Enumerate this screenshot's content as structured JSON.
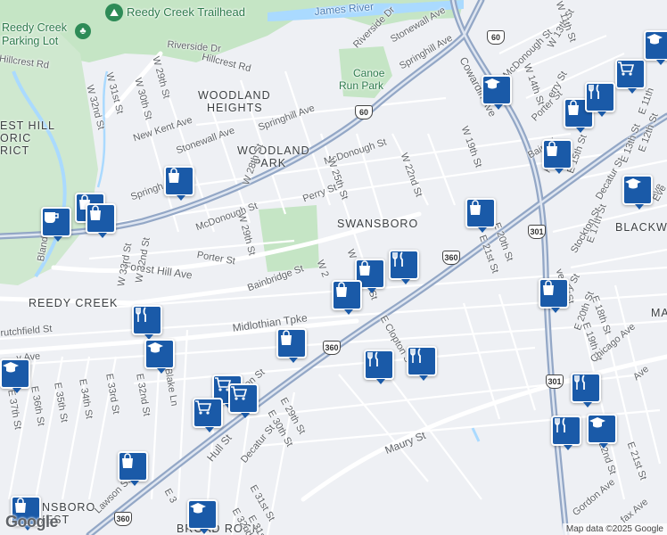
{
  "pois": {
    "trailhead": "Reedy Creek Trailhead",
    "parking_lot_line1": "Reedy Creek",
    "parking_lot_line2": "Parking Lot",
    "canoe_run_park_line1": "Canoe",
    "canoe_run_park_line2": "Run Park"
  },
  "water": {
    "river": "James River"
  },
  "neighborhoods": {
    "woodland_heights_1": "WOODLAND",
    "woodland_heights_2": "HEIGHTS",
    "woodland_park_1": "WOODLAND",
    "woodland_park_2": "PARK",
    "swansboro": "SWANSBORO",
    "reedy_creek": "REEDY CREEK",
    "blackwell": "BLACKWELL",
    "swansboro_west_1": "SWANSBORO",
    "swansboro_west_2": "WEST",
    "broad_rock": "BROAD ROCK",
    "forest_hill_1": "EST HILL",
    "forest_hill_2": "ORIC",
    "forest_hill_3": "RICT",
    "manchester_partial": "MA"
  },
  "streets": {
    "riverside_dr": "Riverside Dr",
    "riverside_dr_2": "Riverside Dr",
    "hillcrest_rd": "Hillcrest Rd",
    "hillcrest_rd_2": "Hillcrest Rd",
    "stonewall_ave": "Stonewall Ave",
    "stonewall_ave_2": "Stonewall Ave",
    "springhill_ave": "Springhill Ave",
    "springhill_ave_2": "Springhill Ave",
    "springhill_partial": "Springh",
    "new_kent_ave": "New Kent Ave",
    "w29th": "W 29th St",
    "w30th": "W 30th St",
    "w31st": "W 31st St",
    "w32nd": "W 32nd St",
    "mcdonough_st": "McDonough St",
    "mcdonough_st_2": "McDonough St",
    "mcdonough_st_3": "McDonough St",
    "w28th": "W 28th St",
    "w29th_2": "W 29th St",
    "perry_st": "Perry St",
    "w25th": "W 25th St",
    "w22nd": "W 22nd St",
    "w19th": "W 19th St",
    "w13th": "W 13th St",
    "w14th": "W 14th St",
    "w11th": "W 11th St",
    "porter_st": "Porter St",
    "porter_st_2": "Porter St",
    "bainbridge_st": "Bainbridge St",
    "forest_hill_ave": "Forest Hill Ave",
    "cowardin_ave": "Cowardin Ave",
    "w2x": "W 2",
    "w_partial": "W",
    "st_partial": "St",
    "midlothian_tpke": "Midlothian Tpke",
    "crutchfield_st": "rutchfield St",
    "bland_st": "Bland St",
    "w33rd": "W 33rd St",
    "w32nd_2": "W 32nd St",
    "ave_partial": "y Ave",
    "blake_ln": "Blake Ln",
    "e32nd": "E 32nd St",
    "e33rd": "E 33rd St",
    "e34th": "E 34th St",
    "e35th": "E 35th St",
    "e36th": "E 36th St",
    "e37th": "E 37th St",
    "clopton_st": "E Clopton St",
    "e29th": "E 29th St",
    "e30th": "E 30th St",
    "e31st": "E 31st St",
    "decatur_st": "Decatur St",
    "decatur_st_2": "Decatur St",
    "hull_st": "Hull St",
    "maury_st": "Maury St",
    "e20th": "E 20th St",
    "e21st": "E 21st St",
    "e15th": "E 15th St",
    "e17th": "E 17th St",
    "e18th": "E 18th St",
    "e19th": "E 19th St",
    "e20th_2": "E 20th St",
    "e13th": "E 13th St",
    "e12th": "E 12th St",
    "e11th": "E 11th",
    "stockton_st": "Stockton St",
    "everett_st": "verett St",
    "chicago_ave": "Chicago Ave",
    "gordon_ave": "Gordon Ave",
    "e22nd": "22nd St",
    "e21st_2": "E 21st St",
    "lawson_st": "Lawson St",
    "e33_partial": "E 3",
    "e31st_2": "E 31st St",
    "e32nd_2": "E 32nd St",
    "bainbridge_partial": "Bainbri",
    "perry_st_2": "erry St",
    "ave_s": "Ave",
    "ury_st": "ury St",
    "ave_partial_2": "Ave",
    "hi": "Hi",
    "ve": "Eve",
    "fax_ave": "fax Ave",
    "ct_partial": "on St"
  },
  "routes": {
    "us60_a": "60",
    "us60_b": "60",
    "us360_a": "360",
    "us360_b": "360",
    "us360_c": "360",
    "us301_a": "301",
    "us301_b": "301"
  },
  "attribution": {
    "logo": "Google",
    "copyright": "Map data ©2025 Google"
  },
  "colors": {
    "pin": "#1a5aa8",
    "park": "#c8e6c9",
    "water": "#aadaff",
    "highway": "#8fa4c4"
  }
}
